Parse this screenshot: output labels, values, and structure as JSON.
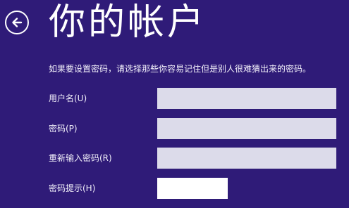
{
  "header": {
    "back_icon": "back-arrow-icon",
    "title": "你的帐户"
  },
  "instruction": "如果要设置密码，请选择那些你容易记住但是别人很难猜出来的密码。",
  "form": {
    "fields": [
      {
        "label": "用户名(U)",
        "value": "",
        "placeholder": ""
      },
      {
        "label": "密码(P)",
        "value": "",
        "placeholder": ""
      },
      {
        "label": "重新输入密码(R)",
        "value": "",
        "placeholder": ""
      },
      {
        "label": "密码提示(H)",
        "value": "",
        "placeholder": ""
      }
    ]
  },
  "colors": {
    "background": "#2f1b78",
    "field": "#dcdbea",
    "field_focused": "#ffffff",
    "text": "#ffffff"
  }
}
